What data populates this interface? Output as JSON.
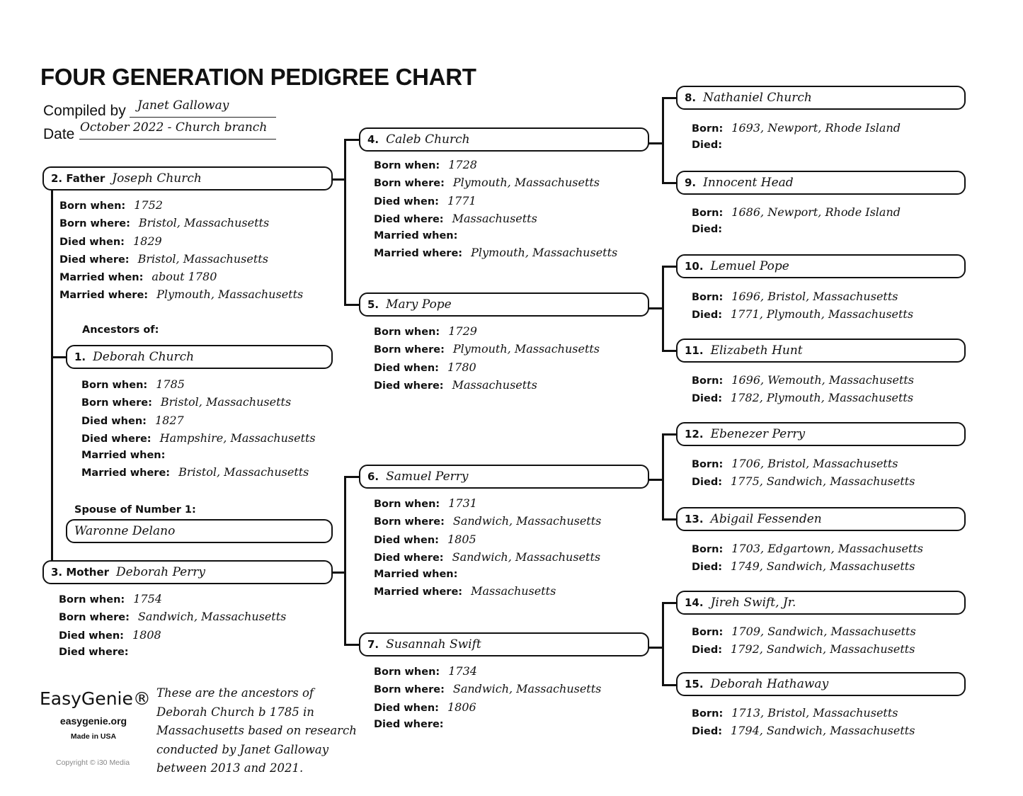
{
  "header": {
    "title": "FOUR GENERATION PEDIGREE CHART",
    "compiled_by_label": "Compiled by",
    "compiled_by_value": "Janet Galloway",
    "date_label": "Date",
    "date_value": "October 2022 - Church branch"
  },
  "labels": {
    "born_when": "Born when:",
    "born_where": "Born where:",
    "died_when": "Died when:",
    "died_where": "Died where:",
    "married_when": "Married when:",
    "married_where": "Married where:",
    "born": "Born:",
    "died": "Died:",
    "ancestors_of": "Ancestors of:",
    "spouse_of": "Spouse of Number 1:"
  },
  "people": {
    "p1": {
      "num": "1.",
      "name": "Deborah Church",
      "born_when": "1785",
      "born_where": "Bristol, Massachusetts",
      "died_when": "1827",
      "died_where": "Hampshire, Massachusetts",
      "married_when": "",
      "married_where": "Bristol, Massachusetts"
    },
    "spouse": {
      "name": "Waronne Delano"
    },
    "p2": {
      "num": "2. Father",
      "name": "Joseph Church",
      "born_when": "1752",
      "born_where": "Bristol, Massachusetts",
      "died_when": "1829",
      "died_where": "Bristol, Massachusetts",
      "married_when": "about 1780",
      "married_where": "Plymouth, Massachusetts"
    },
    "p3": {
      "num": "3. Mother",
      "name": "Deborah Perry",
      "born_when": "1754",
      "born_where": "Sandwich, Massachusetts",
      "died_when": "1808",
      "died_where": ""
    },
    "p4": {
      "num": "4.",
      "name": "Caleb Church",
      "born_when": "1728",
      "born_where": "Plymouth, Massachusetts",
      "died_when": "1771",
      "died_where": "Massachusetts",
      "married_when": "",
      "married_where": "Plymouth, Massachusetts"
    },
    "p5": {
      "num": "5.",
      "name": "Mary Pope",
      "born_when": "1729",
      "born_where": "Plymouth, Massachusetts",
      "died_when": "1780",
      "died_where": "Massachusetts"
    },
    "p6": {
      "num": "6.",
      "name": "Samuel Perry",
      "born_when": "1731",
      "born_where": "Sandwich, Massachusetts",
      "died_when": "1805",
      "died_where": "Sandwich, Massachusetts",
      "married_when": "",
      "married_where": "Massachusetts"
    },
    "p7": {
      "num": "7.",
      "name": "Susannah Swift",
      "born_when": "1734",
      "born_where": "Sandwich, Massachusetts",
      "died_when": "1806",
      "died_where": ""
    },
    "p8": {
      "num": "8.",
      "name": "Nathaniel Church",
      "born": "1693, Newport, Rhode Island",
      "died": ""
    },
    "p9": {
      "num": "9.",
      "name": "Innocent Head",
      "born": "1686, Newport, Rhode Island",
      "died": ""
    },
    "p10": {
      "num": "10.",
      "name": "Lemuel Pope",
      "born": "1696, Bristol, Massachusetts",
      "died": "1771, Plymouth, Massachusetts"
    },
    "p11": {
      "num": "11.",
      "name": "Elizabeth Hunt",
      "born": "1696, Wemouth, Massachusetts",
      "died": "1782, Plymouth, Massachusetts"
    },
    "p12": {
      "num": "12.",
      "name": "Ebenezer Perry",
      "born": "1706, Bristol, Massachusetts",
      "died": "1775, Sandwich, Massachusetts"
    },
    "p13": {
      "num": "13.",
      "name": "Abigail Fessenden",
      "born": "1703, Edgartown, Massachusetts",
      "died": "1749, Sandwich, Massachusetts"
    },
    "p14": {
      "num": "14.",
      "name": "Jireh Swift, Jr.",
      "born": "1709, Sandwich, Massachusetts",
      "died": "1792, Sandwich, Massachusetts"
    },
    "p15": {
      "num": "15.",
      "name": "Deborah Hathaway",
      "born": "1713, Bristol, Massachusetts",
      "died": "1794, Sandwich, Massachusetts"
    }
  },
  "footer": {
    "brand": "EasyGenie®",
    "url": "easygenie.org",
    "made_in": "Made in USA",
    "copyright": "Copyright © i30 Media",
    "note": "These are the ancestors of Deborah Church b 1785 in Massachusetts based on research conducted by Janet Galloway between 2013 and 2021."
  }
}
